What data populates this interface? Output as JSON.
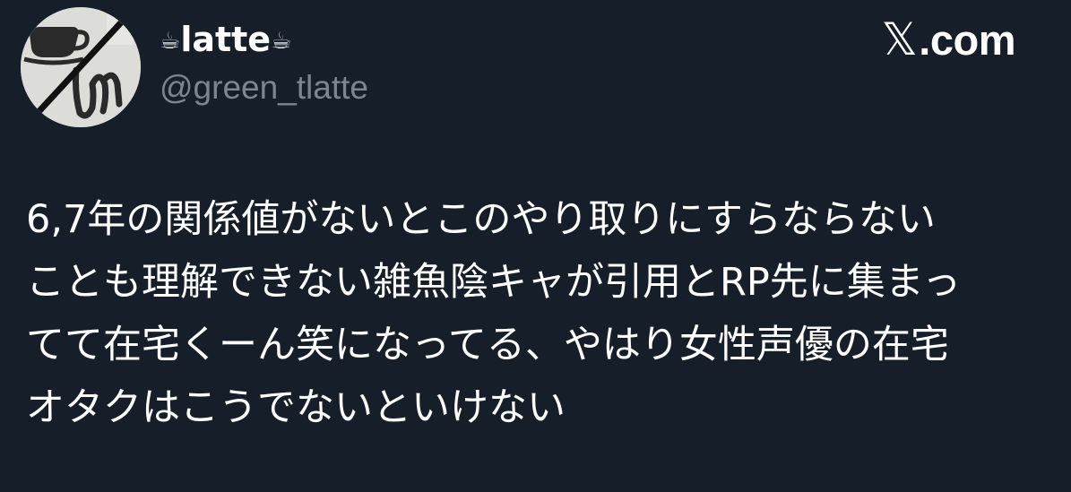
{
  "author": {
    "display_name_cup_left": "☕",
    "display_name_text": "latte",
    "display_name_cup_right": "☕",
    "handle": "@green_tlatte",
    "avatar_icon": "cup-and-bunny-avatar-icon"
  },
  "source": {
    "logo_glyph": "𝕏",
    "domain_suffix": ".com"
  },
  "tweet": {
    "lines": [
      "6,7年の関係値がないとこのやり取りにすらならない",
      "ことも理解できない雑魚陰キャが引用とRP先に集まっ",
      "てて在宅くーん笑になってる、やはり女性声優の在宅",
      "オタクはこうでないといけない"
    ]
  },
  "colors": {
    "background": "#161f29",
    "text": "#ffffff",
    "handle": "#7a8690"
  }
}
